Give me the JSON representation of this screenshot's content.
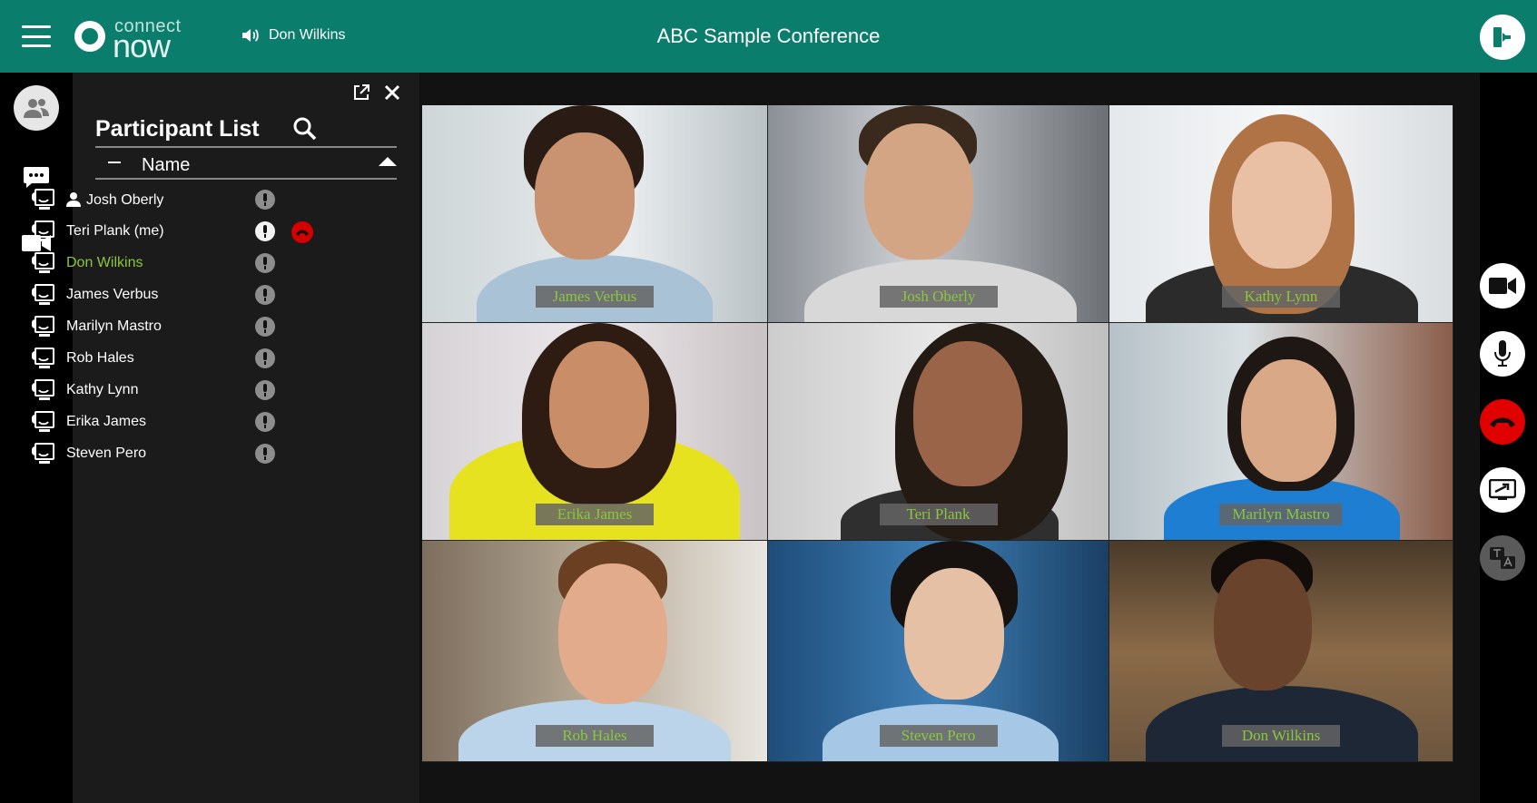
{
  "app": {
    "logo_text_small": "connect",
    "logo_text_large": "now",
    "speaker_name": "Don Wilkins",
    "conference_title": "ABC Sample Conference"
  },
  "panel": {
    "title": "Participant List",
    "column_name": "Name",
    "participants": [
      {
        "name": "Josh Oberly",
        "host": true,
        "active": false,
        "me": false
      },
      {
        "name": "Teri Plank (me)",
        "host": false,
        "active": false,
        "me": true
      },
      {
        "name": "Don Wilkins",
        "host": false,
        "active": true,
        "me": false
      },
      {
        "name": "James Verbus",
        "host": false,
        "active": false,
        "me": false
      },
      {
        "name": "Marilyn Mastro",
        "host": false,
        "active": false,
        "me": false
      },
      {
        "name": "Rob Hales",
        "host": false,
        "active": false,
        "me": false
      },
      {
        "name": "Kathy Lynn",
        "host": false,
        "active": false,
        "me": false
      },
      {
        "name": "Erika James",
        "host": false,
        "active": false,
        "me": false
      },
      {
        "name": "Steven Pero",
        "host": false,
        "active": false,
        "me": false
      }
    ]
  },
  "video_tiles": [
    {
      "name": "James Verbus"
    },
    {
      "name": "Josh Oberly"
    },
    {
      "name": "Kathy Lynn"
    },
    {
      "name": "Erika James"
    },
    {
      "name": "Teri Plank"
    },
    {
      "name": "Marilyn Mastro"
    },
    {
      "name": "Rob Hales"
    },
    {
      "name": "Steven Pero"
    },
    {
      "name": "Don Wilkins"
    }
  ],
  "icons": {
    "menu": "hamburger-icon",
    "exit": "exit-icon",
    "participants": "participants-icon",
    "chat": "chat-icon",
    "video": "video-camera-icon",
    "popout": "popout-icon",
    "close": "close-icon",
    "search": "search-icon",
    "mic": "microphone-icon",
    "hangup": "hangup-icon",
    "screenshare": "screen-share-icon",
    "translate": "translate-icon"
  },
  "colors": {
    "header": "#0a7d6c",
    "active_name": "#8cc63f",
    "hangup": "#e10000"
  }
}
